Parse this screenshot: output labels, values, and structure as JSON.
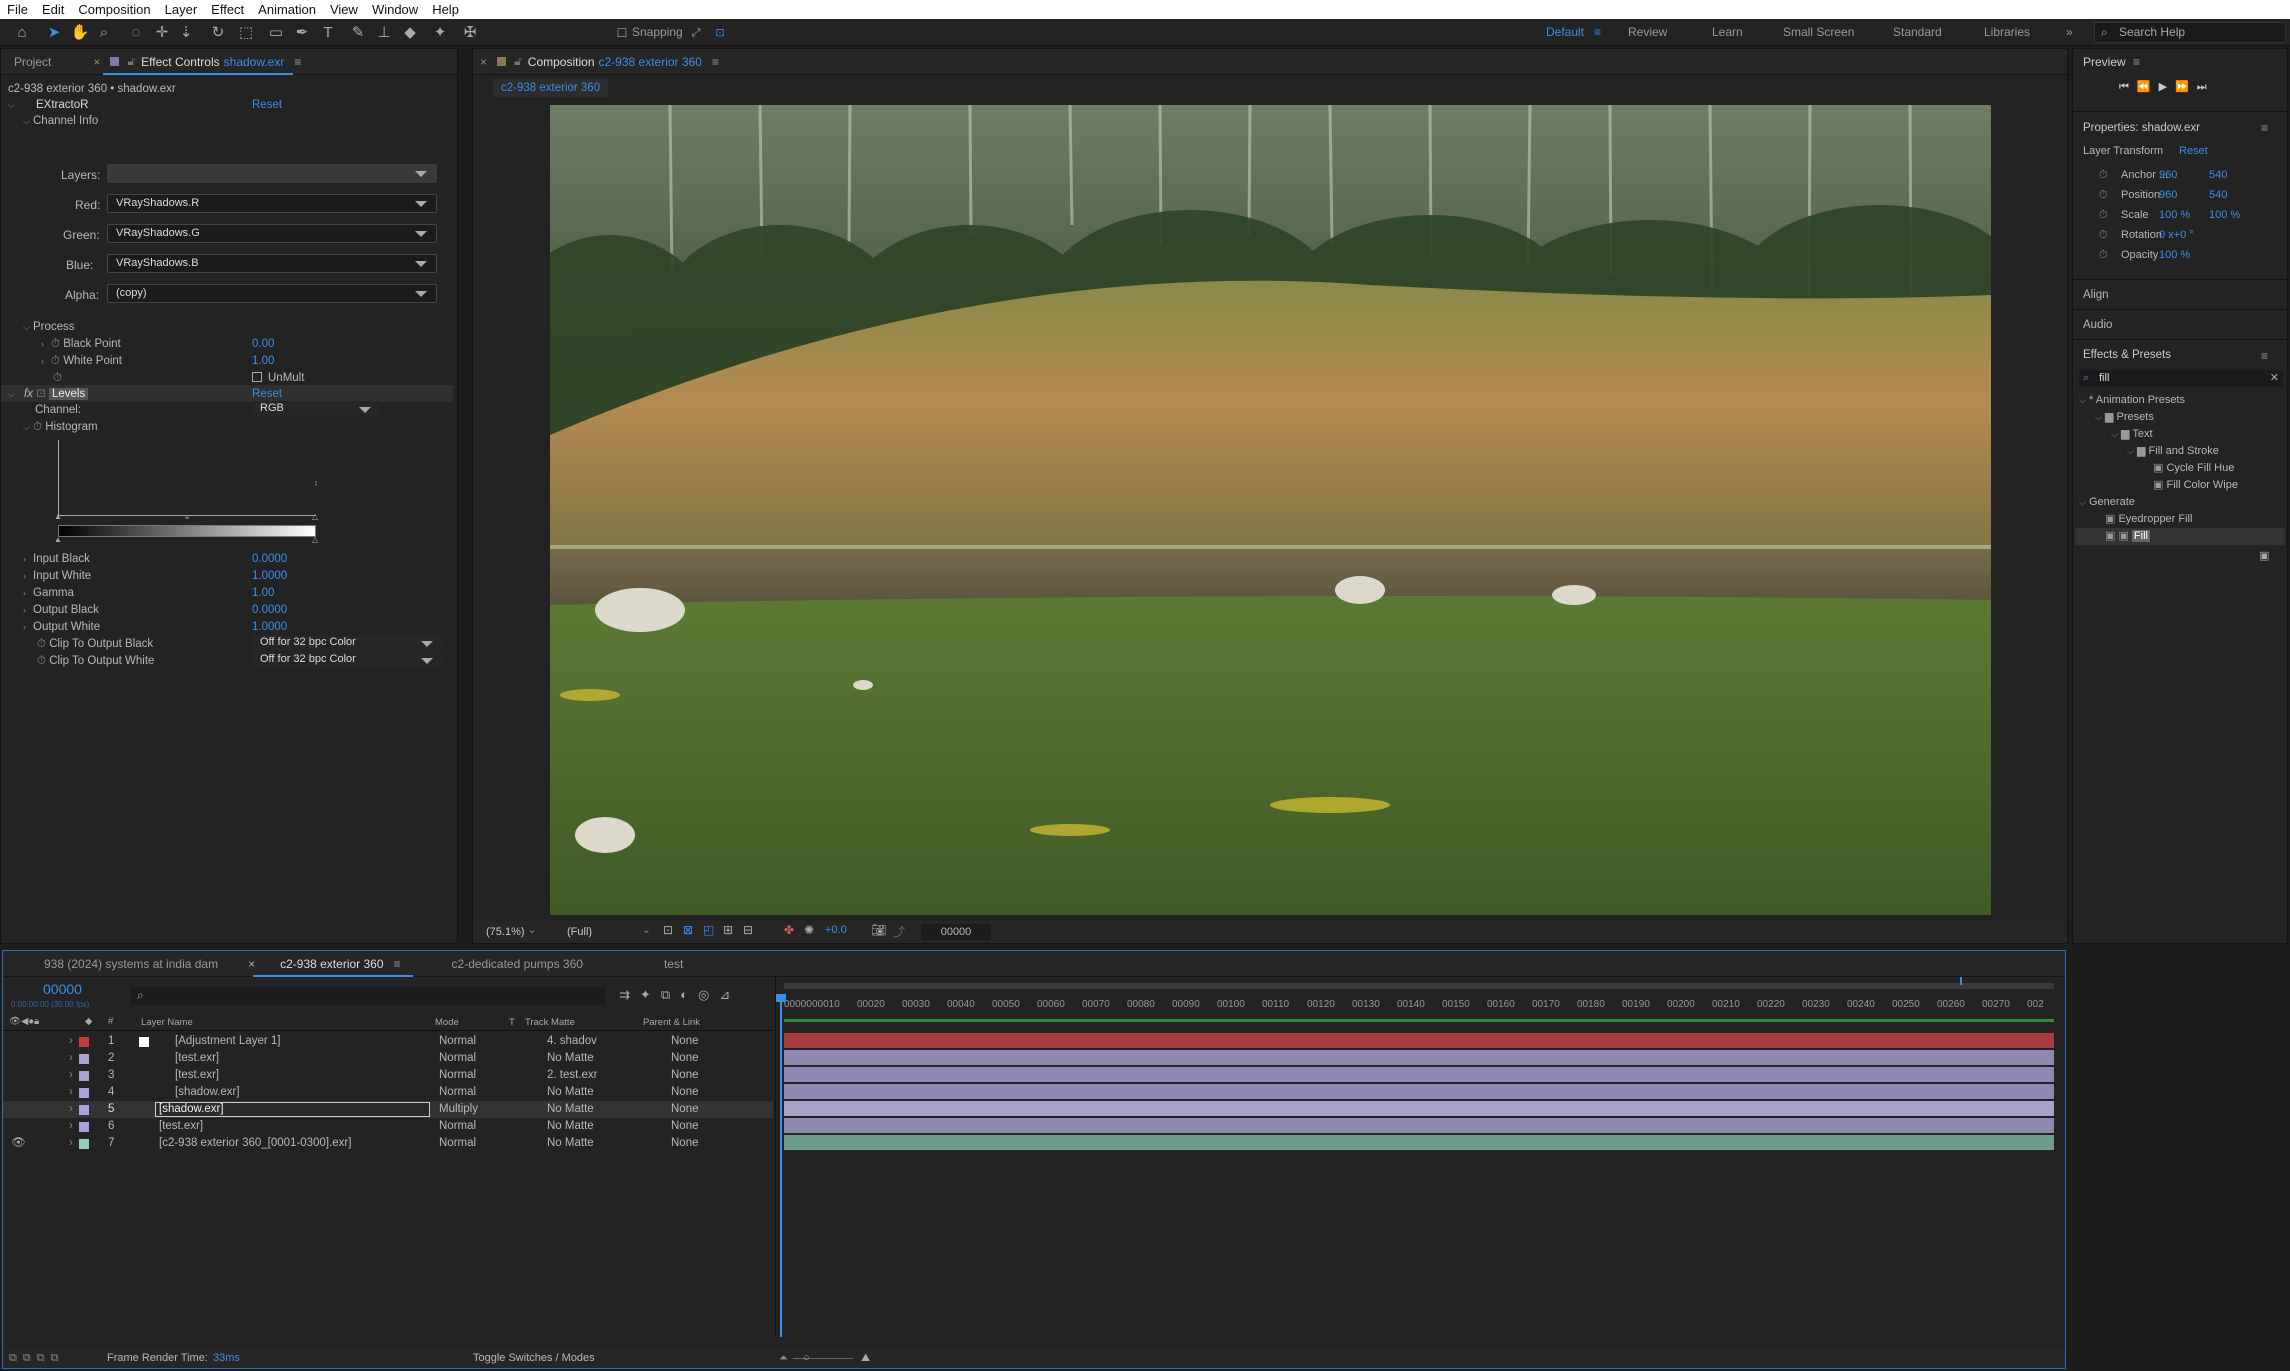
{
  "menu": [
    "File",
    "Edit",
    "Composition",
    "Layer",
    "Effect",
    "Animation",
    "View",
    "Window",
    "Help"
  ],
  "toolbar": {
    "snapping": "Snapping",
    "workspaces": [
      "Default",
      "Review",
      "Learn",
      "Small Screen",
      "Standard",
      "Libraries"
    ],
    "search_help": "Search Help"
  },
  "effect_panel": {
    "tab_project": "Project",
    "tab_effect": "Effect Controls",
    "tab_effect_layer": "shadow.exr",
    "subtitle": "c2-938 exterior 360 • shadow.exr",
    "extractor": {
      "name": "EXtractoR",
      "reset": "Reset",
      "channel_info": "Channel Info",
      "layers_label": "Layers:",
      "red_label": "Red:",
      "red_value": "VRayShadows.R",
      "green_label": "Green:",
      "green_value": "VRayShadows.G",
      "blue_label": "Blue:",
      "blue_value": "VRayShadows.B",
      "alpha_label": "Alpha:",
      "alpha_value": "(copy)",
      "process": "Process",
      "black_point_label": "Black Point",
      "black_point_value": "0.00",
      "white_point_label": "White Point",
      "white_point_value": "1.00",
      "unmult": "UnMult"
    },
    "levels": {
      "fx": "fx",
      "name": "Levels",
      "reset": "Reset",
      "channel_label": "Channel:",
      "channel_value": "RGB",
      "histogram": "Histogram",
      "params": [
        {
          "label": "Input Black",
          "value": "0.0000"
        },
        {
          "label": "Input White",
          "value": "1.0000"
        },
        {
          "label": "Gamma",
          "value": "1.00"
        },
        {
          "label": "Output Black",
          "value": "0.0000"
        },
        {
          "label": "Output White",
          "value": "1.0000"
        }
      ],
      "clip_black_label": "Clip To Output Black",
      "clip_black_value": "Off for 32 bpc Color",
      "clip_white_label": "Clip To Output White",
      "clip_white_value": "Off for 32 bpc Color"
    }
  },
  "composition": {
    "tab_label": "Composition",
    "comp_name": "c2-938 exterior 360",
    "flow_tab": "c2-938 exterior 360",
    "zoom": "(75.1%)",
    "resolution": "(Full)",
    "exposure": "+0.0",
    "timecode": "00000"
  },
  "right_panel": {
    "preview": "Preview",
    "properties_title": "Properties: shadow.exr",
    "layer_transform": "Layer Transform",
    "reset": "Reset",
    "transform": [
      {
        "label": "Anchor ...",
        "v1": "960",
        "v2": "540"
      },
      {
        "label": "Position",
        "v1": "960",
        "v2": "540"
      },
      {
        "label": "Scale",
        "v1": "100 %",
        "v2": "100 %"
      },
      {
        "label": "Rotation",
        "v1": "0 x+0 °",
        "v2": ""
      },
      {
        "label": "Opacity",
        "v1": "100 %",
        "v2": ""
      }
    ],
    "align": "Align",
    "audio": "Audio",
    "effects_presets": "Effects & Presets",
    "search_value": "fill",
    "tree": [
      {
        "label": "* Animation Presets",
        "indent": 0,
        "type": "twirl"
      },
      {
        "label": "Presets",
        "indent": 1,
        "type": "folder"
      },
      {
        "label": "Text",
        "indent": 2,
        "type": "folder"
      },
      {
        "label": "Fill and Stroke",
        "indent": 3,
        "type": "folder"
      },
      {
        "label": "Cycle Fill Hue",
        "indent": 4,
        "type": "preset"
      },
      {
        "label": "Fill Color Wipe",
        "indent": 4,
        "type": "preset"
      },
      {
        "label": "Generate",
        "indent": 0,
        "type": "twirl"
      },
      {
        "label": "Eyedropper Fill",
        "indent": 1,
        "type": "effect"
      },
      {
        "label": "Fill",
        "indent": 1,
        "type": "effect-selected"
      }
    ]
  },
  "timeline": {
    "tabs": [
      {
        "label": "938 (2024) systems at india dam",
        "color": "#6b5a44"
      },
      {
        "label": "c2-938 exterior 360",
        "color": "#6b5a44",
        "active": true
      },
      {
        "label": "c2-dedicated pumps 360",
        "color": "#6b5a44"
      },
      {
        "label": "test",
        "color": "#6b5a44"
      }
    ],
    "timecode": "00000",
    "fps": "0:00:00:00 (30.00 fps)",
    "columns": {
      "layer_name": "Layer Name",
      "mode": "Mode",
      "t": "T",
      "track_matte": "Track Matte",
      "parent": "Parent & Link"
    },
    "ruler": [
      "00000",
      "00010",
      "00020",
      "00030",
      "00040",
      "00050",
      "00060",
      "00070",
      "00080",
      "00090",
      "00100",
      "00110",
      "00120",
      "00130",
      "00140",
      "00150",
      "00160",
      "00170",
      "00180",
      "00190",
      "00200",
      "00210",
      "00220",
      "00230",
      "00240",
      "00250",
      "00260",
      "00270",
      "002"
    ],
    "layers": [
      {
        "num": "1",
        "name": "[Adjustment Layer 1]",
        "mode": "Normal",
        "matte": "4. shadov",
        "parent": "None",
        "label": "#c43c3c",
        "bar": "#a83b3f"
      },
      {
        "num": "2",
        "name": "[test.exr]",
        "mode": "Normal",
        "matte": "No Matte",
        "parent": "None",
        "label": "#a9a4d8",
        "bar": "#8d88b0"
      },
      {
        "num": "3",
        "name": "[test.exr]",
        "mode": "Normal",
        "matte": "2. test.exr",
        "parent": "None",
        "label": "#a9a4d8",
        "bar": "#8d88b0"
      },
      {
        "num": "4",
        "name": "[shadow.exr]",
        "mode": "Normal",
        "matte": "No Matte",
        "parent": "None",
        "label": "#a9a4d8",
        "bar": "#8d88b0"
      },
      {
        "num": "5",
        "name": "[shadow.exr]",
        "mode": "Multiply",
        "matte": "No Matte",
        "parent": "None",
        "label": "#a9a4d8",
        "bar": "#a7a3c8",
        "selected": true
      },
      {
        "num": "6",
        "name": "[test.exr]",
        "mode": "Normal",
        "matte": "No Matte",
        "parent": "None",
        "label": "#a9a4d8",
        "bar": "#8d88b0"
      },
      {
        "num": "7",
        "name": "[c2-938 exterior 360_[0001-0300].exr]",
        "mode": "Normal",
        "matte": "No Matte",
        "parent": "None",
        "label": "#8fd0b8",
        "bar": "#6e9c8c"
      }
    ],
    "render_time_label": "Frame Render Time:",
    "render_time_value": "33ms",
    "toggle": "Toggle Switches / Modes"
  }
}
